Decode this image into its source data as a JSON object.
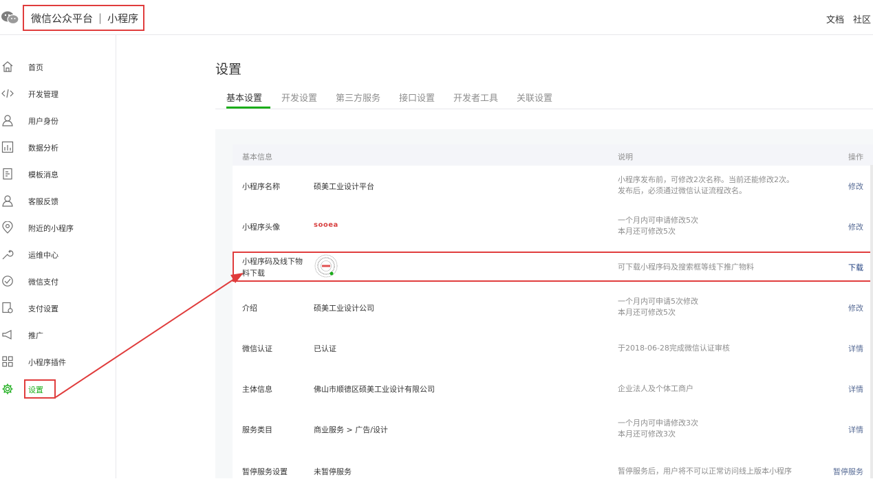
{
  "header": {
    "brand": "微信公众平台",
    "product": "小程序",
    "links": [
      "文档",
      "社区"
    ]
  },
  "sidebar": {
    "items": [
      {
        "label": "首页",
        "icon": "home-icon"
      },
      {
        "label": "开发管理",
        "icon": "code-icon"
      },
      {
        "label": "用户身份",
        "icon": "user-icon"
      },
      {
        "label": "数据分析",
        "icon": "chart-icon"
      },
      {
        "label": "模板消息",
        "icon": "document-icon"
      },
      {
        "label": "客服反馈",
        "icon": "service-icon"
      },
      {
        "label": "附近的小程序",
        "icon": "location-icon"
      },
      {
        "label": "运维中心",
        "icon": "wrench-icon"
      },
      {
        "label": "微信支付",
        "icon": "pay-icon"
      },
      {
        "label": "支付设置",
        "icon": "pay-settings-icon"
      },
      {
        "label": "推广",
        "icon": "megaphone-icon"
      },
      {
        "label": "小程序插件",
        "icon": "plugin-icon"
      },
      {
        "label": "设置",
        "icon": "gear-icon"
      }
    ],
    "active": "设置"
  },
  "main": {
    "title": "设置",
    "tabs": [
      "基本设置",
      "开发设置",
      "第三方服务",
      "接口设置",
      "开发者工具",
      "关联设置"
    ],
    "table": {
      "headers": {
        "info": "基本信息",
        "desc": "说明",
        "op": "操作"
      },
      "rows": [
        {
          "name": "小程序名称",
          "value": "硕美工业设计平台",
          "desc": [
            "小程序发布前，可修改2次名称。当前还能修改2次。",
            "发布后，必须通过微信认证流程改名。"
          ],
          "op": "修改"
        },
        {
          "name": "小程序头像",
          "value": "sooea",
          "desc": [
            "一个月内可申请修改5次",
            "本月还可修改5次"
          ],
          "op": "修改"
        },
        {
          "name": [
            "小程序码及线下物",
            "料下载"
          ],
          "value": "",
          "desc": [
            "可下载小程序码及搜索框等线下推广物料"
          ],
          "op": "下载"
        },
        {
          "name": "介绍",
          "value": "硕美工业设计公司",
          "desc": [
            "一个月内可申请5次修改",
            "本月还可修改5次"
          ],
          "op": "修改"
        },
        {
          "name": "微信认证",
          "value": "已认证",
          "desc": [
            "于2018-06-28完成微信认证审核"
          ],
          "op": "详情"
        },
        {
          "name": "主体信息",
          "value": "佛山市顺德区硕美工业设计有限公司",
          "desc": [
            "企业法人及个体工商户"
          ],
          "op": "详情"
        },
        {
          "name": "服务类目",
          "value": "商业服务 > 广告/设计",
          "desc": [
            "一个月内可申请修改3次",
            "本月还可修改3次"
          ],
          "op": "详情"
        },
        {
          "name": "暂停服务设置",
          "value": "未暂停服务",
          "desc": [
            "暂停服务后，用户将不可以正常访问线上版本小程序"
          ],
          "op": "暂停服务"
        }
      ]
    }
  },
  "colors": {
    "accent": "#1aad19",
    "link": "#576b95",
    "highlight": "#e03c3c"
  }
}
